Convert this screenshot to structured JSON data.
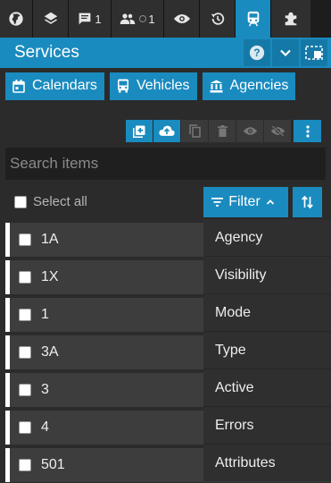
{
  "tabs": [
    {
      "icon": "globe-icon",
      "active": false
    },
    {
      "icon": "layers-icon",
      "active": false
    },
    {
      "icon": "chat-icon",
      "count": "1",
      "active": false
    },
    {
      "icon": "users-icon",
      "count": "1",
      "active": false
    },
    {
      "icon": "eye-icon",
      "active": false
    },
    {
      "icon": "history-icon",
      "active": false
    },
    {
      "icon": "train-icon",
      "active": true
    },
    {
      "icon": "puzzle-icon",
      "active": false
    }
  ],
  "header": {
    "title": "Services",
    "help_icon": "help-icon",
    "collapse_icon": "chevron-down-icon",
    "window_icon": "window-icon"
  },
  "subtabs": [
    {
      "label": "Calendars",
      "icon": "calendar-icon"
    },
    {
      "label": "Vehicles",
      "icon": "bus-icon"
    },
    {
      "label": "Agencies",
      "icon": "bank-icon"
    }
  ],
  "toolbar": [
    "add-icon",
    "upload-icon",
    "copy-icon",
    "delete-icon",
    "show-icon",
    "hide-icon",
    "more-icon"
  ],
  "search": {
    "placeholder": "Search items"
  },
  "select_all": {
    "label": "Select all"
  },
  "filter": {
    "label": "Filter"
  },
  "items": [
    {
      "label": "1A"
    },
    {
      "label": "1X"
    },
    {
      "label": "1"
    },
    {
      "label": "3A"
    },
    {
      "label": "3"
    },
    {
      "label": "4"
    },
    {
      "label": "501"
    }
  ],
  "filter_menu": [
    {
      "label": "Agency"
    },
    {
      "label": "Visibility"
    },
    {
      "label": "Mode"
    },
    {
      "label": "Type"
    },
    {
      "label": "Active"
    },
    {
      "label": "Errors"
    },
    {
      "label": "Attributes"
    }
  ],
  "colors": {
    "accent": "#1a8bbf",
    "background": "#2b2b2b",
    "row": "#3d3d3d"
  }
}
